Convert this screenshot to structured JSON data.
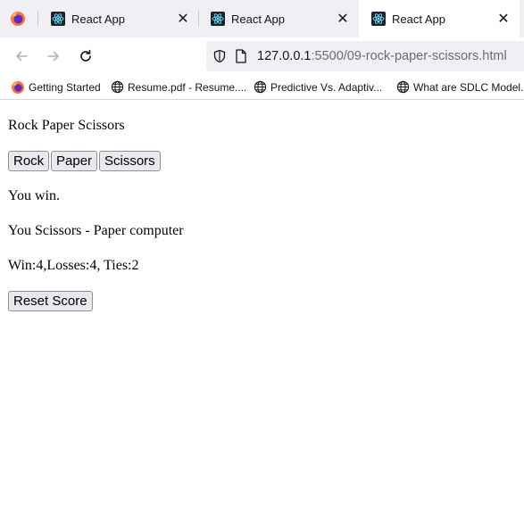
{
  "browser": {
    "tabs": [
      {
        "title": "React App",
        "active": false
      },
      {
        "title": "React App",
        "active": false
      },
      {
        "title": "React App",
        "active": true
      }
    ],
    "url": {
      "host": "127.0.0.1",
      "rest": ":5500/09-rock-paper-scissors.html"
    },
    "bookmarks": [
      {
        "label": "Getting Started",
        "icon": "firefox-icon"
      },
      {
        "label": "Resume.pdf - Resume....",
        "icon": "globe-icon"
      },
      {
        "label": "Predictive Vs. Adaptiv...",
        "icon": "globe-icon"
      },
      {
        "label": "What are SDLC Model..."
      }
    ],
    "colors": {
      "tabstrip_bg": "#f0f0f4",
      "react_cyan": "#61dafb"
    }
  },
  "page": {
    "title": "Rock Paper Scissors",
    "buttons": {
      "rock": "Rock",
      "paper": "Paper",
      "scissors": "Scissors",
      "reset": "Reset Score"
    },
    "result": "You win.",
    "moves": "You Scissors - Paper computer",
    "score": "Win:4,Losses:4, Ties:2"
  }
}
